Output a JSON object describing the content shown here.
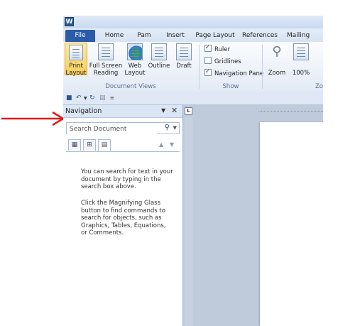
{
  "app": {
    "icon_letter": "W"
  },
  "tabs": [
    "File",
    "Home",
    "Pam",
    "Insert",
    "Page Layout",
    "References",
    "Mailing"
  ],
  "ribbon": {
    "document_views": {
      "buttons": [
        {
          "line1": "Print",
          "line2": "Layout"
        },
        {
          "line1": "Full Screen",
          "line2": "Reading"
        },
        {
          "line1": "Web",
          "line2": "Layout"
        },
        {
          "line1": "Outline",
          "line2": ""
        },
        {
          "line1": "Draft",
          "line2": ""
        }
      ],
      "group_label": "Document Views"
    },
    "show": {
      "checkboxes": [
        {
          "label": "Ruler",
          "checked": true
        },
        {
          "label": "Gridlines",
          "checked": false
        },
        {
          "label": "Navigation Pane",
          "checked": true
        }
      ],
      "group_label": "Show"
    },
    "zoom": {
      "buttons": [
        "Zoom",
        "100%"
      ],
      "group_label": "Zo"
    }
  },
  "navigation": {
    "title": "Navigation",
    "search_placeholder": "Search Document",
    "help_text_1": "You can search for text in your document by typing in the search box above.",
    "help_text_2": "Click the Magnifying Glass button to find commands to search for objects, such as Graphics, Tables, Equations, or Comments."
  },
  "annotation": {
    "arrow_color": "#e11b1b"
  },
  "colors": {
    "file_tab": "#2a5caa",
    "ribbon_bg": "#e2eaf5"
  },
  "icons": [
    "word-icon",
    "save-icon",
    "undo-icon",
    "redo-icon",
    "search-icon",
    "close-icon"
  ]
}
